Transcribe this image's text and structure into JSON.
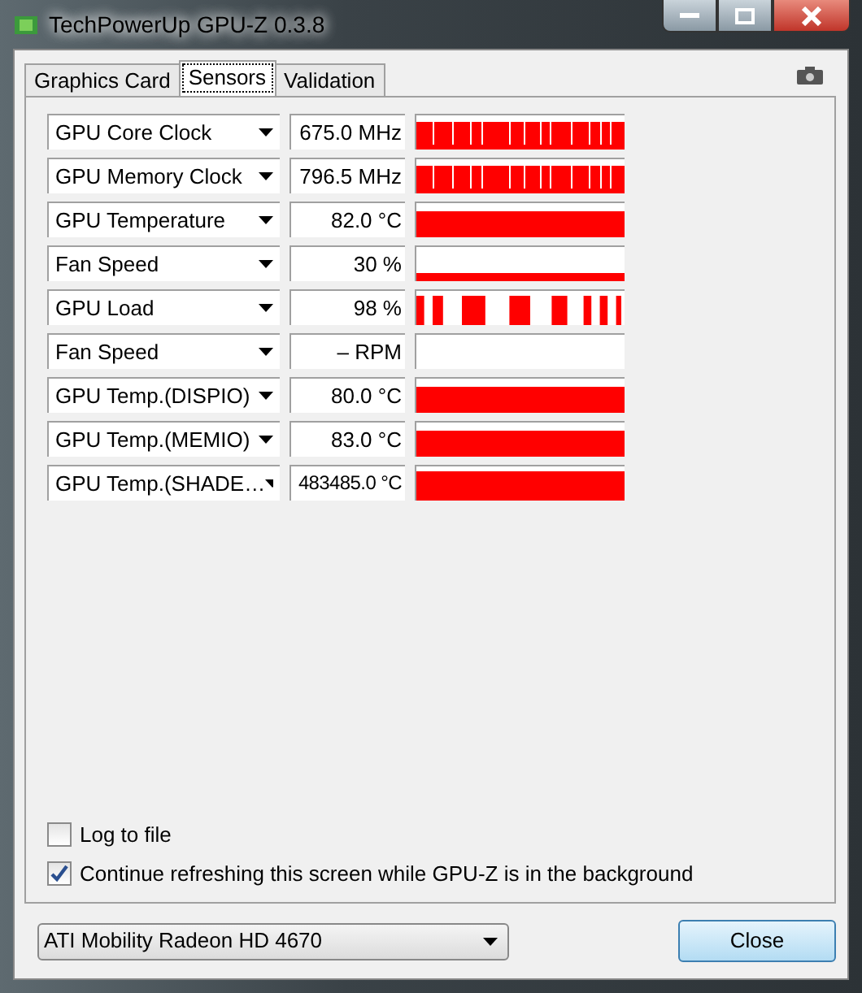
{
  "window": {
    "title": "TechPowerUp GPU-Z 0.3.8"
  },
  "tabs": [
    {
      "label": "Graphics Card",
      "selected": false
    },
    {
      "label": "Sensors",
      "selected": true
    },
    {
      "label": "Validation",
      "selected": false
    }
  ],
  "sensors": [
    {
      "name": "GPU Core Clock",
      "value": "675.0 MHz",
      "kind": "dips"
    },
    {
      "name": "GPU Memory Clock",
      "value": "796.5 MHz",
      "kind": "dips"
    },
    {
      "name": "GPU Temperature",
      "value": "82.0 °C",
      "kind": "solid"
    },
    {
      "name": "Fan Speed",
      "value": "30 %",
      "kind": "low"
    },
    {
      "name": "GPU Load",
      "value": "98 %",
      "kind": "gaps"
    },
    {
      "name": "Fan Speed",
      "value": "– RPM",
      "kind": "empty"
    },
    {
      "name": "GPU Temp.(DISPIO)",
      "value": "80.0 °C",
      "kind": "solid"
    },
    {
      "name": "GPU Temp.(MEMIO)",
      "value": "83.0 °C",
      "kind": "solid"
    },
    {
      "name": "GPU Temp.(SHADE…",
      "value": "483485.0 °C",
      "kind": "full"
    }
  ],
  "options": [
    {
      "label": "Log to file",
      "checked": false
    },
    {
      "label": "Continue refreshing this screen while GPU-Z is in the background",
      "checked": true
    }
  ],
  "device": {
    "value": "ATI Mobility Radeon HD 4670"
  },
  "buttons": [
    "Close"
  ]
}
